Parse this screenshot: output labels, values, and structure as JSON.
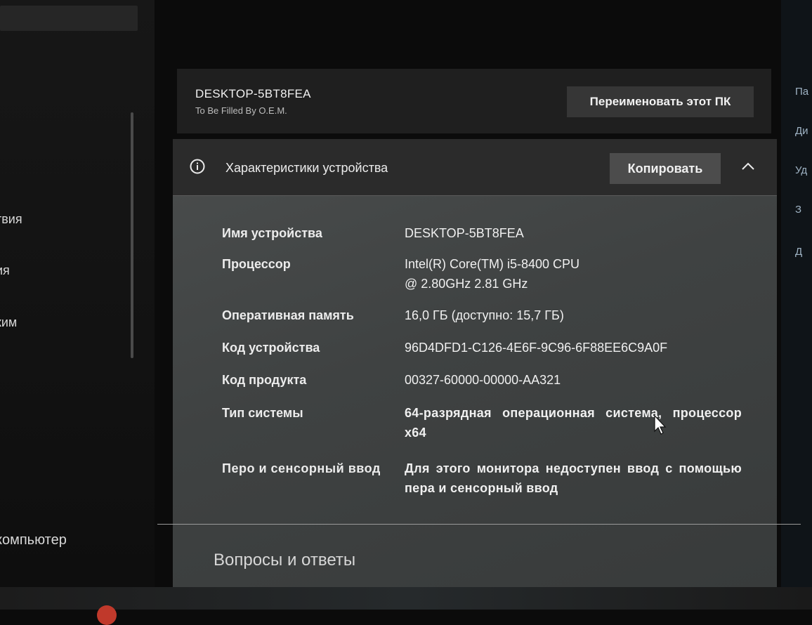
{
  "sidebar": {
    "items": [
      {
        "label": "твия"
      },
      {
        "label": "ия"
      },
      {
        "label": "ким"
      },
      {
        "label": "компьютер"
      }
    ]
  },
  "right_edge": {
    "items": [
      {
        "label": "Па"
      },
      {
        "label": "Ди"
      },
      {
        "label": "Уд"
      },
      {
        "label": "З"
      },
      {
        "label": "Д"
      }
    ]
  },
  "pc_header": {
    "name": "DESKTOP-5BT8FEA",
    "manufacturer": "To Be Filled By O.E.M.",
    "rename_label": "Переименовать этот ПК"
  },
  "specs": {
    "title": "Характеристики устройства",
    "copy_label": "Копировать",
    "icons": {
      "info": "info-icon",
      "collapse": "chevron-up-icon"
    },
    "rows": [
      {
        "label": "Имя устройства",
        "value": "DESKTOP-5BT8FEA"
      },
      {
        "label": "Процессор",
        "value": "Intel(R) Core(TM) i5-8400 CPU @ 2.80GHz   2.81 GHz"
      },
      {
        "label": "Оперативная память",
        "value": "16,0 ГБ (доступно: 15,7 ГБ)"
      },
      {
        "label": "Код устройства",
        "value": "96D4DFD1-C126-4E6F-9C96-6F88EE6C9A0F"
      },
      {
        "label": "Код продукта",
        "value": "00327-60000-00000-AA321"
      },
      {
        "label": "Тип системы",
        "value": "64-разрядная операционная система, процессор x64"
      },
      {
        "label": "Перо и сенсорный ввод",
        "value": "Для этого монитора недоступен ввод с помощью пера и сенсорный ввод"
      }
    ]
  },
  "faq": {
    "title": "Вопросы и ответы"
  }
}
